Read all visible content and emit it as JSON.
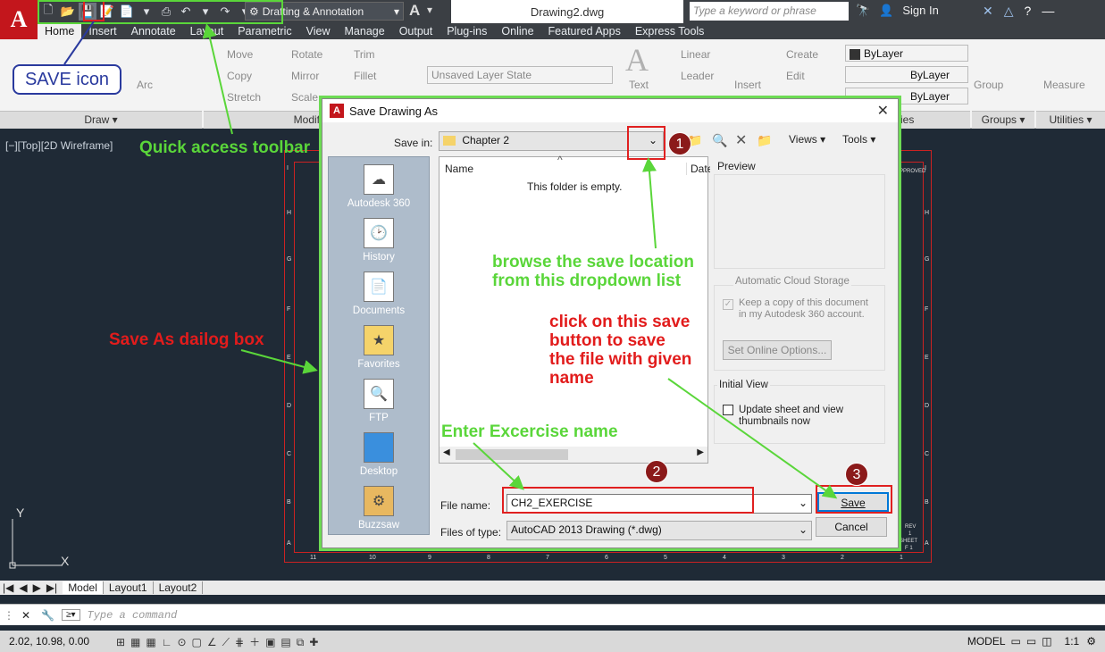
{
  "app": {
    "logo": "A",
    "workspace": "Drafting & Annotation",
    "document_title": "Drawing2.dwg",
    "search_placeholder": "Type a keyword or phrase",
    "sign_in": "Sign In"
  },
  "ribbon_tabs": [
    "Home",
    "Insert",
    "Annotate",
    "Layout",
    "Parametric",
    "View",
    "Manage",
    "Output",
    "Plug-ins",
    "Online",
    "Featured Apps",
    "Express Tools"
  ],
  "ribbon": {
    "draw_tools": {
      "arc": "Arc"
    },
    "modify_tools": {
      "move": "Move",
      "rotate": "Rotate",
      "trim": "Trim",
      "copy": "Copy",
      "mirror": "Mirror",
      "fillet": "Fillet",
      "stretch": "Stretch",
      "scale": "Scale"
    },
    "layer_state": "Unsaved Layer State",
    "annotation_tools": {
      "text": "Text",
      "linear": "Linear",
      "leader": "Leader"
    },
    "block_tools": {
      "insert": "Insert",
      "create": "Create",
      "edit": "Edit"
    },
    "properties": {
      "color": "ByLayer",
      "linetype": "ByLayer",
      "lineweight": "ByLayer"
    },
    "groups": "Group",
    "utilities": "Measure",
    "panels": {
      "draw": "Draw",
      "modify": "Modif",
      "properties": "ies",
      "groups": "Groups",
      "utilities": "Utilities"
    }
  },
  "viewport": {
    "label": "[−][Top][2D Wireframe]",
    "row_letters": [
      "I",
      "H",
      "G",
      "F",
      "E",
      "D",
      "C",
      "B",
      "A"
    ],
    "col_numbers": [
      "11",
      "10",
      "9",
      "8",
      "7",
      "6",
      "5",
      "4",
      "3",
      "2",
      "1"
    ],
    "title_block": {
      "approved": "APPROVED",
      "rev": "REV",
      "rev_no": "1",
      "sheet": "SHEET",
      "sheet_no": "F 1"
    },
    "ucs_y": "Y",
    "ucs_x": "X"
  },
  "layout_tabs": [
    "Model",
    "Layout1",
    "Layout2"
  ],
  "command": {
    "placeholder": "Type a command"
  },
  "status": {
    "coords": "2.02, 10.98, 0.00",
    "model": "MODEL",
    "scale": "1:1"
  },
  "dialog": {
    "title": "Save Drawing As",
    "save_in_label": "Save in:",
    "save_in_value": "Chapter 2",
    "views": "Views",
    "tools": "Tools",
    "places": [
      "Autodesk 360",
      "History",
      "Documents",
      "Favorites",
      "FTP",
      "Desktop",
      "Buzzsaw"
    ],
    "col_name": "Name",
    "col_date": "Date",
    "empty_msg": "This folder is empty.",
    "preview_label": "Preview",
    "cloud_label": "Automatic Cloud Storage",
    "cloud_check": "Keep a copy of this document in my Autodesk 360 account.",
    "online_options": "Set Online Options...",
    "initial_view_label": "Initial View",
    "update_thumb": "Update sheet and view thumbnails now",
    "file_name_label": "File name:",
    "file_name_value": "CH2_EXERCISE",
    "file_type_label": "Files of type:",
    "file_type_value": "AutoCAD 2013 Drawing (*.dwg)",
    "save_btn": "Save",
    "cancel_btn": "Cancel"
  },
  "annotations": {
    "save_icon": "SAVE icon",
    "qat": "Quick access toolbar",
    "browse": "browse the save location\nfrom this dropdown list",
    "save_button_note": "click on this save\nbutton to save\nthe file with given\nname",
    "dialog_note": "Save As dailog box",
    "exercise_note": "Enter Excercise name",
    "badge1": "1",
    "badge2": "2",
    "badge3": "3"
  }
}
